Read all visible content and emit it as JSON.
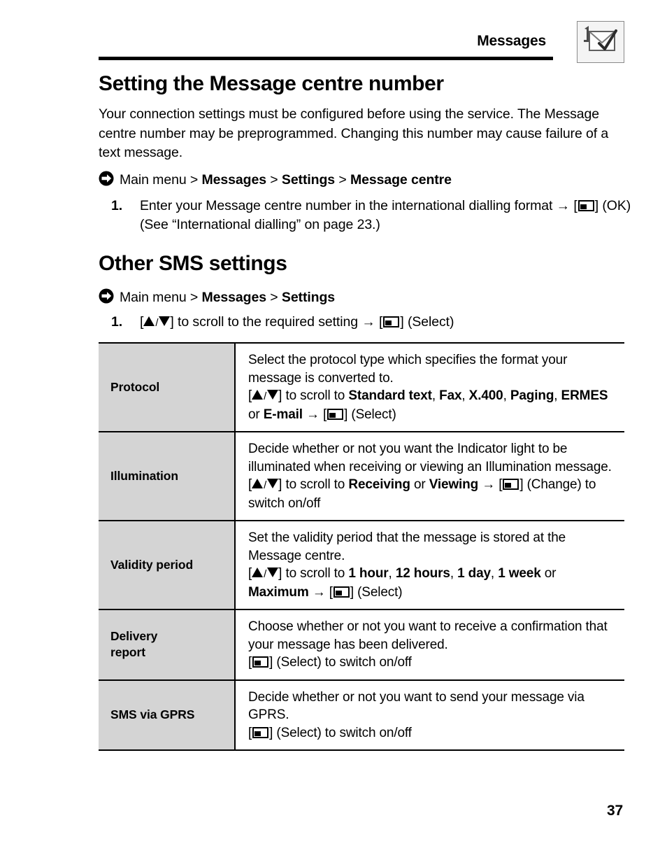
{
  "header": {
    "title": "Messages",
    "icon_name": "envelope-with-one-badge-icon"
  },
  "sections": [
    {
      "heading": "Setting the Message centre number",
      "intro": "Your connection settings must be configured before using the service. The Message centre number may be preprogrammed. Changing this number may cause failure of a text message.",
      "path": {
        "root": "Main menu",
        "sep": ">",
        "crumbs": [
          "Messages",
          "Settings",
          "Message centre"
        ]
      },
      "step": {
        "number": "1.",
        "text_a": "Enter your Message centre number in the international dialling format",
        "arrow": "→",
        "text_b": "(OK) (See “International dialling” on page 23.)"
      }
    },
    {
      "heading": "Other SMS settings",
      "path": {
        "root": "Main menu",
        "sep": ">",
        "crumbs": [
          "Messages",
          "Settings"
        ]
      },
      "step": {
        "number": "1.",
        "text_a": "to scroll to the required setting",
        "arrow": "→",
        "text_b": "(Select)"
      }
    }
  ],
  "table": {
    "rows": [
      {
        "key": "Protocol",
        "line1": "Select the protocol type which specifies the format your message is converted to.",
        "scroll_prefix": "to scroll to",
        "options": [
          "Standard text",
          "Fax",
          "X.400",
          "Paging",
          "ERMES"
        ],
        "options_last_conjunction": "or",
        "options_last": "E-mail",
        "arrow": "→",
        "action": "(Select)"
      },
      {
        "key": "Illumination",
        "line1": "Decide whether or not you want the Indicator light to be illuminated when receiving or viewing an Illumination message.",
        "scroll_prefix": "to scroll to",
        "options": [
          "Receiving"
        ],
        "options_last_conjunction": "or",
        "options_last": "Viewing",
        "arrow": "→",
        "action": "(Change) to switch on/off"
      },
      {
        "key": "Validity period",
        "line1": "Set the validity period that the message is stored at the Message centre.",
        "scroll_prefix": "to scroll to",
        "options": [
          "1 hour",
          "12 hours",
          "1 day",
          "1 week"
        ],
        "options_last_conjunction": "or",
        "options_last": "Maximum",
        "arrow": "→",
        "action": "(Select)"
      },
      {
        "key": "Delivery report",
        "key_line1": "Delivery",
        "key_line2": "report",
        "line1": "Choose whether or not you want to receive a confirmation that your message has been delivered.",
        "action": "(Select) to switch on/off"
      },
      {
        "key": "SMS via GPRS",
        "line1": "Decide whether or not you want to send your message via GPRS.",
        "action": "(Select) to switch on/off"
      }
    ]
  },
  "footer": {
    "page_number": "37"
  }
}
